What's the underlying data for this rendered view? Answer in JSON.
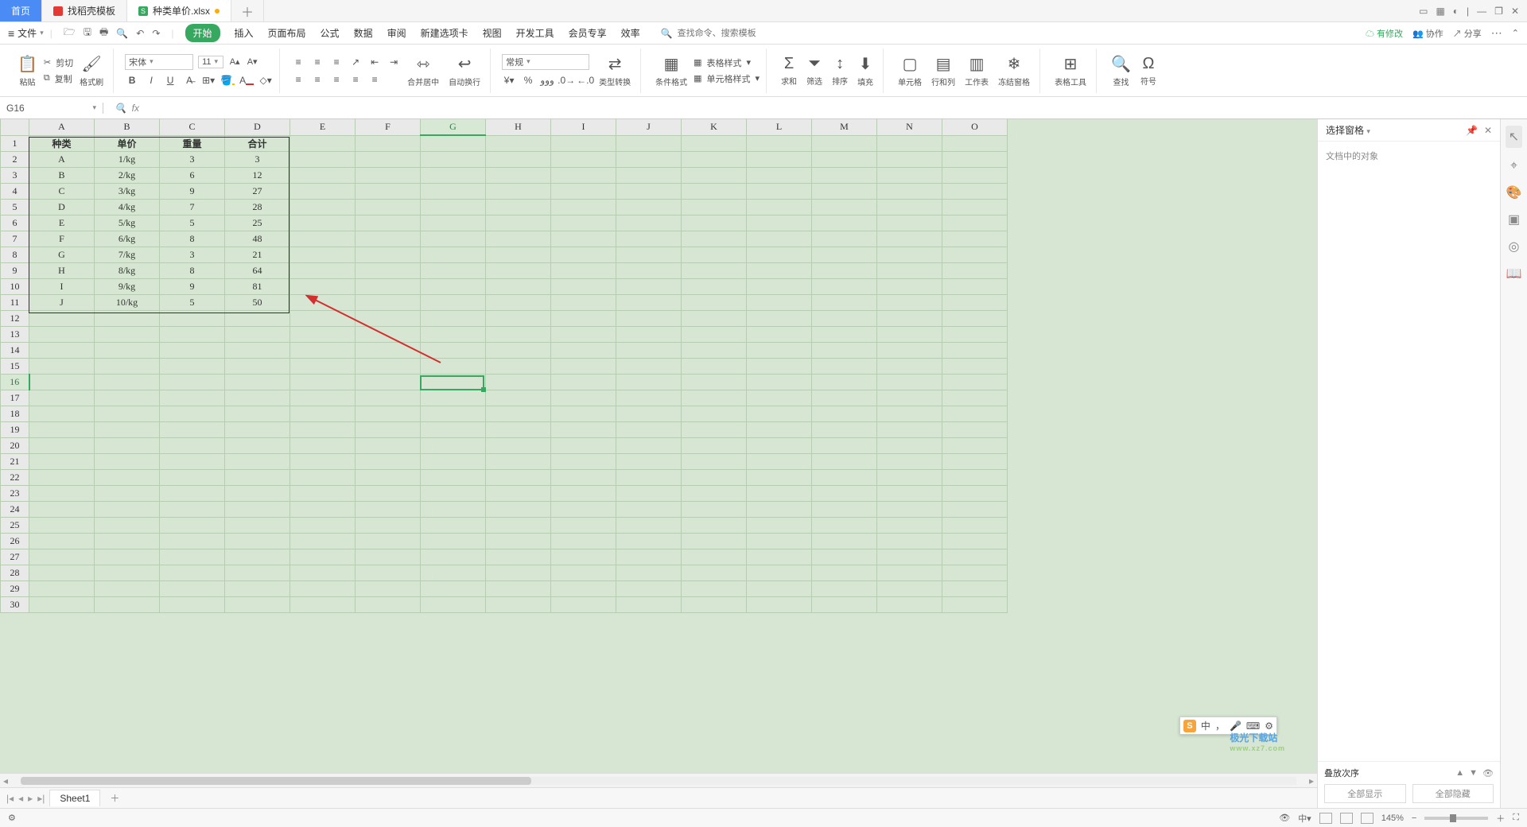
{
  "titlebar": {
    "home": "首页",
    "tab_template": "找稻壳模板",
    "doc_tab": "种类单价.xlsx",
    "add": "＋",
    "minimize": "—",
    "restore": "❐",
    "close": "✕"
  },
  "menubar": {
    "file": "文件",
    "tabs": {
      "start": "开始",
      "insert": "插入",
      "page_layout": "页面布局",
      "formula": "公式",
      "data": "数据",
      "review": "审阅",
      "new_tab": "新建选项卡",
      "view": "视图",
      "dev": "开发工具",
      "member": "会员专享",
      "eff": "效率"
    },
    "search_placeholder": "查找命令、搜索模板",
    "cloud_status": "有修改",
    "collab": "协作",
    "share": "分享"
  },
  "ribbon": {
    "paste": "粘贴",
    "cut": "剪切",
    "copy": "复制",
    "format_painter": "格式刷",
    "font_name": "宋体",
    "font_size": "11",
    "merge_center": "合并居中",
    "wrap": "自动换行",
    "number_format": "常规",
    "type_convert": "类型转换",
    "cond_format": "条件格式",
    "table_style": "表格样式",
    "cell_style": "单元格样式",
    "sum": "求和",
    "filter": "筛选",
    "sort": "排序",
    "fill": "填充",
    "cell": "单元格",
    "row_col": "行和列",
    "sheet": "工作表",
    "freeze": "冻结窗格",
    "table_tool": "表格工具",
    "find": "查找",
    "symbol": "符号"
  },
  "namebox": "G16",
  "fx": "fx",
  "columns": [
    "A",
    "B",
    "C",
    "D",
    "E",
    "F",
    "G",
    "H",
    "I",
    "J",
    "K",
    "L",
    "M",
    "N",
    "O"
  ],
  "row_count": 30,
  "selection": {
    "col": 6,
    "row": 16
  },
  "table": {
    "headers": [
      "种类",
      "单价",
      "重量",
      "合计"
    ],
    "rows": [
      [
        "A",
        "1/kg",
        "3",
        "3"
      ],
      [
        "B",
        "2/kg",
        "6",
        "12"
      ],
      [
        "C",
        "3/kg",
        "9",
        "27"
      ],
      [
        "D",
        "4/kg",
        "7",
        "28"
      ],
      [
        "E",
        "5/kg",
        "5",
        "25"
      ],
      [
        "F",
        "6/kg",
        "8",
        "48"
      ],
      [
        "G",
        "7/kg",
        "3",
        "21"
      ],
      [
        "H",
        "8/kg",
        "8",
        "64"
      ],
      [
        "I",
        "9/kg",
        "9",
        "81"
      ],
      [
        "J",
        "10/kg",
        "5",
        "50"
      ]
    ]
  },
  "sheet_tabs": {
    "sheet1": "Sheet1"
  },
  "right_panel": {
    "title": "选择窗格",
    "subtitle": "文档中的对象",
    "order": "叠放次序",
    "show_all": "全部显示",
    "hide_all": "全部隐藏"
  },
  "ime": {
    "lang": "中",
    "mode": "，"
  },
  "status": {
    "zoom": "145%"
  },
  "watermark": {
    "name": "极光下载站",
    "url": "www.xz7.com"
  }
}
